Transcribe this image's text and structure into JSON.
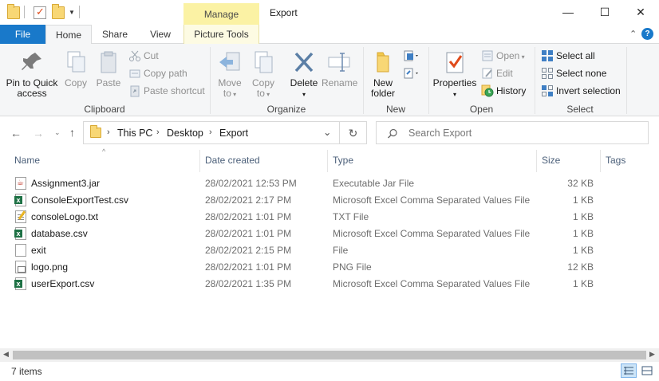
{
  "window": {
    "title": "Export",
    "contextual_tab_group": "Manage",
    "controls": {
      "minimize": "—",
      "maximize": "☐",
      "close": "✕"
    }
  },
  "ribbon_tabs": {
    "file": "File",
    "home": "Home",
    "share": "Share",
    "view": "View",
    "picture_tools": "Picture Tools",
    "collapse_glyph": "⌃",
    "help_glyph": "?"
  },
  "ribbon": {
    "clipboard": {
      "label": "Clipboard",
      "pin_to_quick_access": [
        "Pin to Quick",
        "access"
      ],
      "copy": "Copy",
      "paste": "Paste",
      "cut": "Cut",
      "copy_path": "Copy path",
      "paste_shortcut": "Paste shortcut"
    },
    "organize": {
      "label": "Organize",
      "move_to": "Move",
      "move_to_2": "to",
      "copy_to": "Copy",
      "copy_to_2": "to",
      "delete": "Delete",
      "rename": "Rename"
    },
    "new": {
      "label": "New",
      "new_folder": [
        "New",
        "folder"
      ]
    },
    "open": {
      "label": "Open",
      "properties": "Properties",
      "open": "Open",
      "edit": "Edit",
      "history": "History"
    },
    "select": {
      "label": "Select",
      "select_all": "Select all",
      "select_none": "Select none",
      "invert_selection": "Invert selection"
    }
  },
  "navigation": {
    "breadcrumb": [
      "This PC",
      "Desktop",
      "Export"
    ],
    "search_placeholder": "Search Export",
    "dropdown_glyph": "⌄",
    "refresh_glyph": "↻"
  },
  "file_list": {
    "columns": {
      "name": "Name",
      "date_created": "Date created",
      "type": "Type",
      "size": "Size",
      "tags": "Tags"
    },
    "sort_indicator": "^",
    "rows": [
      {
        "icon": "jar-file-icon",
        "name": "Assignment3.jar",
        "date": "28/02/2021 12:53 PM",
        "type": "Executable Jar File",
        "size": "32 KB"
      },
      {
        "icon": "excel-csv-icon",
        "name": "ConsoleExportTest.csv",
        "date": "28/02/2021 2:17 PM",
        "type": "Microsoft Excel Comma Separated Values File",
        "size": "1 KB"
      },
      {
        "icon": "text-file-icon",
        "name": "consoleLogo.txt",
        "date": "28/02/2021 1:01 PM",
        "type": "TXT File",
        "size": "1 KB"
      },
      {
        "icon": "excel-csv-icon",
        "name": "database.csv",
        "date": "28/02/2021 1:01 PM",
        "type": "Microsoft Excel Comma Separated Values File",
        "size": "1 KB"
      },
      {
        "icon": "generic-file-icon",
        "name": "exit",
        "date": "28/02/2021 2:15 PM",
        "type": "File",
        "size": "1 KB"
      },
      {
        "icon": "png-image-icon",
        "name": "logo.png",
        "date": "28/02/2021 1:01 PM",
        "type": "PNG File",
        "size": "12 KB"
      },
      {
        "icon": "excel-csv-icon",
        "name": "userExport.csv",
        "date": "28/02/2021 1:35 PM",
        "type": "Microsoft Excel Comma Separated Values File",
        "size": "1 KB"
      }
    ]
  },
  "status": {
    "item_count": "7 items"
  },
  "colors": {
    "accent": "#1979ca",
    "manage_tab": "#fbf2a4",
    "ribbon_bg": "#f5f6f7",
    "excel_green": "#1e7145",
    "folder_yellow": "#f8d775"
  }
}
